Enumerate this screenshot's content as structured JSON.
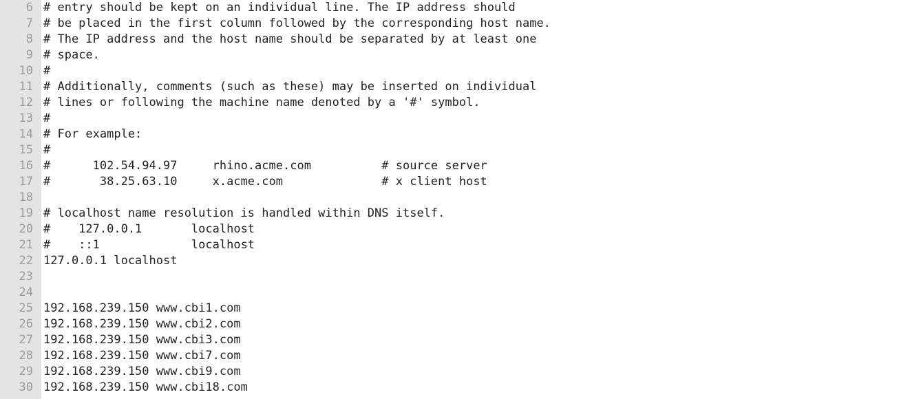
{
  "editor": {
    "file_kind": "hosts-file",
    "first_visible_line": 6,
    "colors": {
      "gutter_background": "#e4e4e4",
      "line_number_text": "#9a9a9a",
      "code_text": "#232323",
      "editor_background": "#ffffff"
    },
    "lines": [
      {
        "number": "6",
        "text": "# entry should be kept on an individual line. The IP address should"
      },
      {
        "number": "7",
        "text": "# be placed in the first column followed by the corresponding host name."
      },
      {
        "number": "8",
        "text": "# The IP address and the host name should be separated by at least one"
      },
      {
        "number": "9",
        "text": "# space."
      },
      {
        "number": "10",
        "text": "#"
      },
      {
        "number": "11",
        "text": "# Additionally, comments (such as these) may be inserted on individual"
      },
      {
        "number": "12",
        "text": "# lines or following the machine name denoted by a '#' symbol."
      },
      {
        "number": "13",
        "text": "#"
      },
      {
        "number": "14",
        "text": "# For example:"
      },
      {
        "number": "15",
        "text": "#"
      },
      {
        "number": "16",
        "text": "#      102.54.94.97     rhino.acme.com          # source server"
      },
      {
        "number": "17",
        "text": "#       38.25.63.10     x.acme.com              # x client host"
      },
      {
        "number": "18",
        "text": ""
      },
      {
        "number": "19",
        "text": "# localhost name resolution is handled within DNS itself."
      },
      {
        "number": "20",
        "text": "#    127.0.0.1       localhost"
      },
      {
        "number": "21",
        "text": "#    ::1             localhost"
      },
      {
        "number": "22",
        "text": "127.0.0.1 localhost"
      },
      {
        "number": "23",
        "text": ""
      },
      {
        "number": "24",
        "text": ""
      },
      {
        "number": "25",
        "text": "192.168.239.150 www.cbi1.com"
      },
      {
        "number": "26",
        "text": "192.168.239.150 www.cbi2.com"
      },
      {
        "number": "27",
        "text": "192.168.239.150 www.cbi3.com"
      },
      {
        "number": "28",
        "text": "192.168.239.150 www.cbi7.com"
      },
      {
        "number": "29",
        "text": "192.168.239.150 www.cbi9.com"
      },
      {
        "number": "30",
        "text": "192.168.239.150 www.cbi18.com"
      }
    ]
  }
}
